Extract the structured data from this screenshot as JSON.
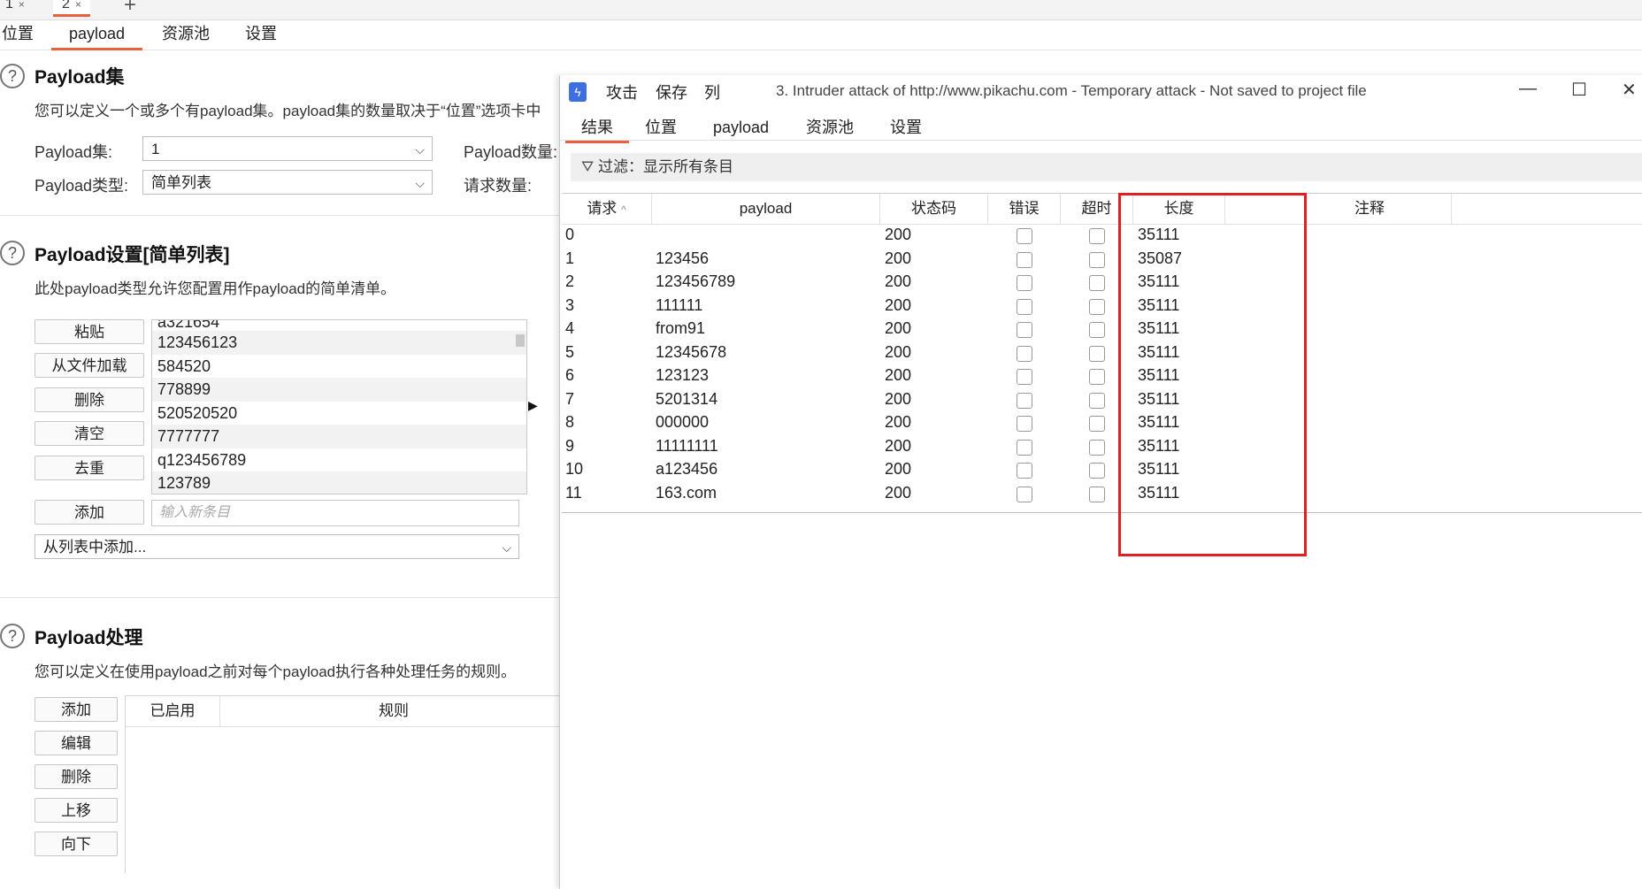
{
  "project_tabs": [
    {
      "label": "1",
      "close": "×"
    },
    {
      "label": "2",
      "close": "×"
    }
  ],
  "add_tab": "+",
  "main_tabs": [
    "位置",
    "payload",
    "资源池",
    "设置"
  ],
  "payload_sets": {
    "title": "Payload集",
    "desc": "您可以定义一个或多个有payload集。payload集的数量取决于“位置”选项卡中",
    "set_label": "Payload集:",
    "set_value": "1",
    "type_label": "Payload类型:",
    "type_value": "简单列表",
    "count_label": "Payload数量:",
    "req_label": "请求数量:"
  },
  "payload_settings": {
    "title": "Payload设置[简单列表]",
    "desc": "此处payload类型允许您配置用作payload的简单清单。",
    "buttons": [
      "粘贴",
      "从文件加载",
      "删除",
      "清空",
      "去重"
    ],
    "partial_item": "a321654",
    "items": [
      "123456123",
      "584520",
      "778899",
      "520520520",
      "7777777",
      "q123456789",
      "123789"
    ],
    "add_button": "添加",
    "add_placeholder": "输入新条目",
    "add_from_list": "从列表中添加..."
  },
  "payload_processing": {
    "title": "Payload处理",
    "desc": "您可以定义在使用payload之前对每个payload执行各种处理任务的规则。",
    "buttons": [
      "添加",
      "编辑",
      "删除",
      "上移",
      "向下"
    ],
    "col_enabled": "已启用",
    "col_rule": "规则"
  },
  "intruder": {
    "menu": [
      "攻击",
      "保存",
      "列"
    ],
    "caption": "3. Intruder attack of http://www.pikachu.com - Temporary attack - Not saved to project file",
    "win_min": "—",
    "win_max": "☐",
    "win_close": "✕",
    "tabs": [
      "结果",
      "位置",
      "payload",
      "资源池",
      "设置"
    ],
    "filter": "过滤：显示所有条目",
    "columns": {
      "request": "请求",
      "sort": "^",
      "payload": "payload",
      "status": "状态码",
      "error": "错误",
      "timeout": "超时",
      "length": "长度",
      "comment": "注释"
    },
    "rows": [
      {
        "req": "0",
        "payload": "",
        "status": "200",
        "length": "35111"
      },
      {
        "req": "1",
        "payload": "123456",
        "status": "200",
        "length": "35087"
      },
      {
        "req": "2",
        "payload": "123456789",
        "status": "200",
        "length": "35111"
      },
      {
        "req": "3",
        "payload": "111111",
        "status": "200",
        "length": "35111"
      },
      {
        "req": "4",
        "payload": "from91",
        "status": "200",
        "length": "35111"
      },
      {
        "req": "5",
        "payload": "12345678",
        "status": "200",
        "length": "35111"
      },
      {
        "req": "6",
        "payload": "123123",
        "status": "200",
        "length": "35111"
      },
      {
        "req": "7",
        "payload": "5201314",
        "status": "200",
        "length": "35111"
      },
      {
        "req": "8",
        "payload": "000000",
        "status": "200",
        "length": "35111"
      },
      {
        "req": "9",
        "payload": "11111111",
        "status": "200",
        "length": "35111"
      },
      {
        "req": "10",
        "payload": "a123456",
        "status": "200",
        "length": "35111"
      },
      {
        "req": "11",
        "payload": "163.com",
        "status": "200",
        "length": "35111"
      }
    ]
  },
  "colors": {
    "accent": "#e8603c",
    "highlight": "#e02020",
    "burp_icon": "#3d6fe0"
  }
}
